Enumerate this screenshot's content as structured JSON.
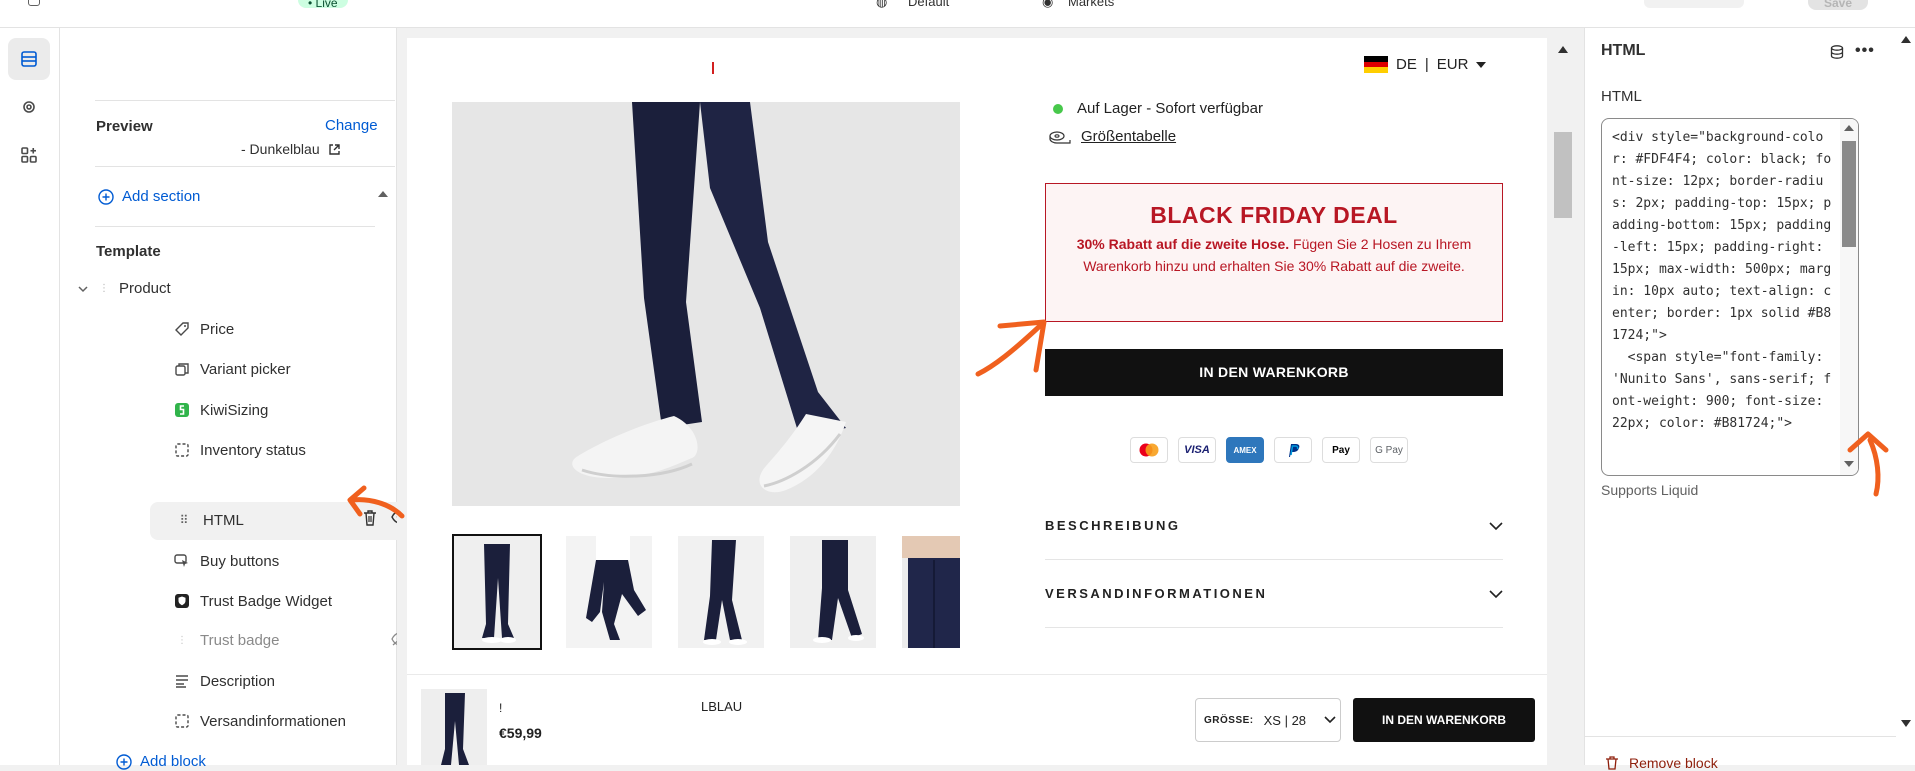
{
  "topbar": {
    "live_label": "• Live",
    "theme_label": "Default",
    "market_label": "Markets",
    "save_label": "Save"
  },
  "sidebar": {
    "preview_label": "Preview",
    "change_label": "Change",
    "theme_name": "- Dunkelblau",
    "add_section": "Add section",
    "template_label": "Template",
    "product_label": "Product",
    "items": [
      {
        "label": "Price"
      },
      {
        "label": "Variant picker"
      },
      {
        "label": "KiwiSizing"
      },
      {
        "label": "Inventory status"
      },
      {
        "label": "HTML"
      },
      {
        "label": "Buy buttons"
      },
      {
        "label": "Trust Badge Widget"
      },
      {
        "label": "Trust badge"
      },
      {
        "label": "Description"
      },
      {
        "label": "Versandinformationen"
      }
    ],
    "add_block": "Add block"
  },
  "preview": {
    "lang": "DE",
    "divider": "|",
    "currency": "EUR",
    "stock_text": "Auf Lager - Sofort verfügbar",
    "size_chart": "Größentabelle",
    "promo": {
      "title": "BLACK FRIDAY DEAL",
      "bold": "30% Rabatt auf die zweite Hose.",
      "text": " Fügen Sie 2 Hosen zu Ihrem Warenkorb hinzu und erhalten Sie 30% Rabatt auf die zweite.",
      "bg_color": "#FDF4F4",
      "accent_color": "#B81724"
    },
    "cart_button": "IN DEN WARENKORB",
    "payments": [
      "Mastercard",
      "VISA",
      "AMEX",
      "PayPal",
      "Apple Pay",
      "G Pay"
    ],
    "accordions": [
      "BESCHREIBUNG",
      "VERSANDINFORMATIONEN"
    ],
    "sticky": {
      "name": "!",
      "price": "€59,99",
      "color": "LBLAU",
      "size_label": "GRÖSSE:",
      "size_value": "XS | 28",
      "button": "IN DEN WARENKORB"
    }
  },
  "panel": {
    "title": "HTML",
    "field_label": "HTML",
    "code": "<div style=\"background-color: #FDF4F4; color: black; font-size: 12px; border-radius: 2px; padding-top: 15px; padding-bottom: 15px; padding-left: 15px; padding-right: 15px; max-width: 500px; margin: 10px auto; text-align: center; border: 1px solid #B81724;\">\n  <span style=\"font-family: 'Nunito Sans', sans-serif; font-weight: 900; font-size: 22px; color: #B81724;\">",
    "help": "Supports Liquid",
    "remove": "Remove block"
  }
}
